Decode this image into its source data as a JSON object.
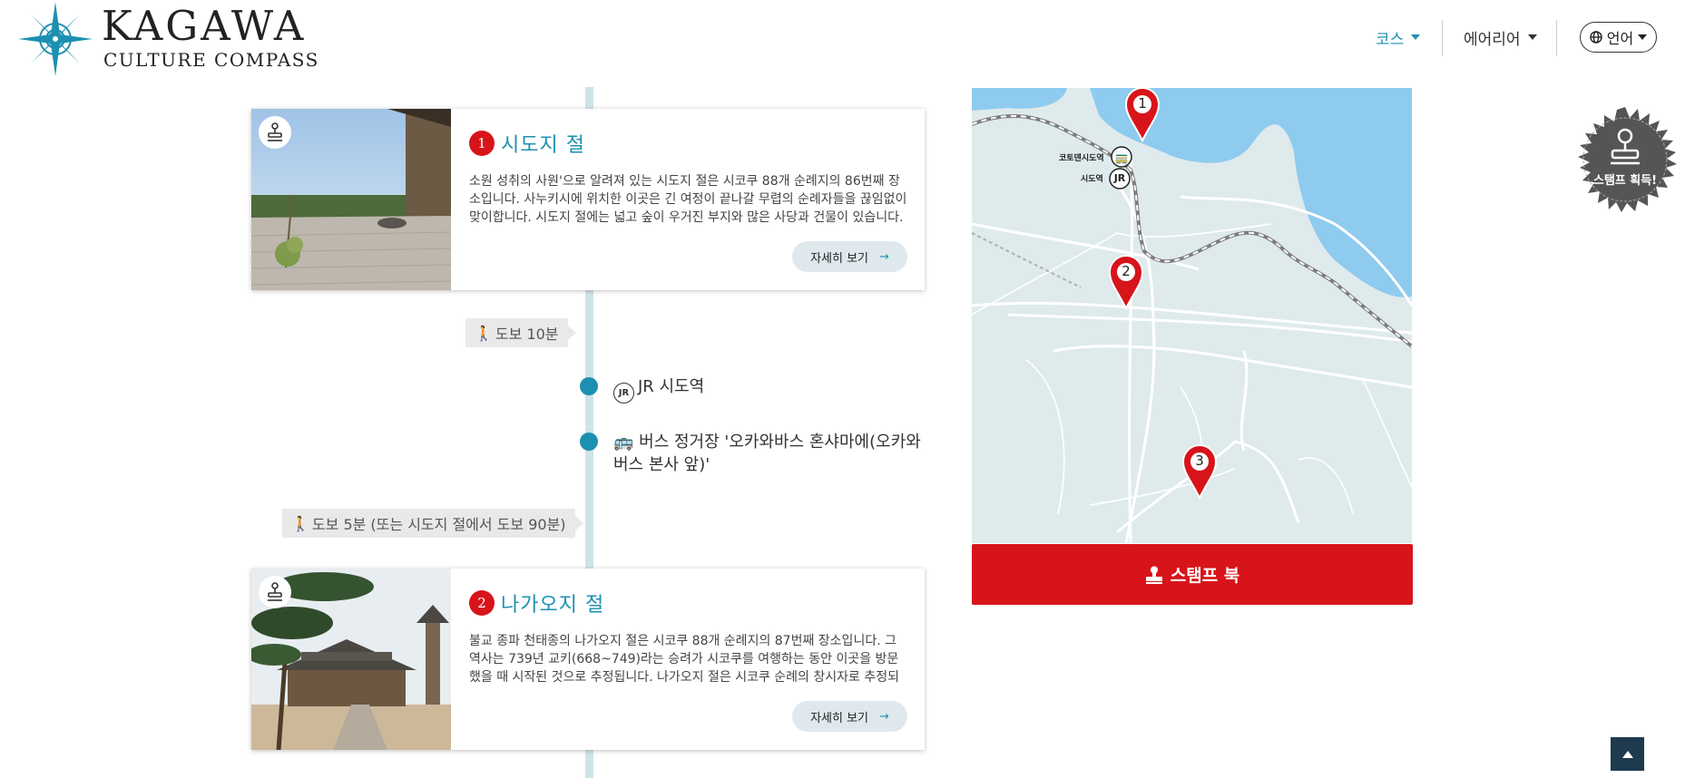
{
  "brand": {
    "title": "KAGAWA",
    "subtitle": "CULTURE COMPASS",
    "accent": "#1c90b1"
  },
  "nav": {
    "course_label": "코스",
    "area_label": "에어리어",
    "language_label": "언어"
  },
  "course": {
    "spots": [
      {
        "number": "1",
        "title": "시도지 절",
        "description": "소원 성취의 사원'으로 알려져 있는 시도지 절은 시코쿠 88개 순례지의 86번째 장소입니다. 사누키시에 위치한 이곳은 긴 여정이 끝나갈 무렵의 순례자들을 끊임없이 맞이합니다. 시도지 절에는 넓고 숲이 우거진 부지와 많은 사당과 건물이 있습니다.",
        "more_label": "자세히 보기"
      },
      {
        "number": "2",
        "title": "나가오지 절",
        "description": "불교 종파 천태종의 나가오지 절은 시코쿠 88개 순례지의 87번째 장소입니다. 그 역사는 739년 교키(668~749)라는 승려가 시코쿠를 여행하는 동안 이곳을 방문했을 때 시작된 것으로 추정됩니다. 나가오지 절은 시코쿠 순례의 창시자로 추정되는 구카이와도 관련이 있습니다.",
        "more_label": "자세히 보기"
      }
    ],
    "walk1": "도보 10분",
    "stop1": "JR 시도역",
    "stop1_icon": "JR",
    "stop2": "버스 정거장 '오카와바스 혼샤마에(오카와 버스 본사 앞)'",
    "walk2": "도보 5분 (또는 시도지 절에서 도보 90분)"
  },
  "map": {
    "station1": "코토덴시도역",
    "station2": "시도역",
    "jr_mark": "JR",
    "pins": [
      "1",
      "2",
      "3"
    ]
  },
  "stamp_book_label": "스탬프 북",
  "stamp_badge_label": "스탬프 획득!",
  "colors": {
    "accent": "#1c90b1",
    "red": "#d7141a",
    "sea": "#8ecbee",
    "land": "#dfeaec"
  }
}
